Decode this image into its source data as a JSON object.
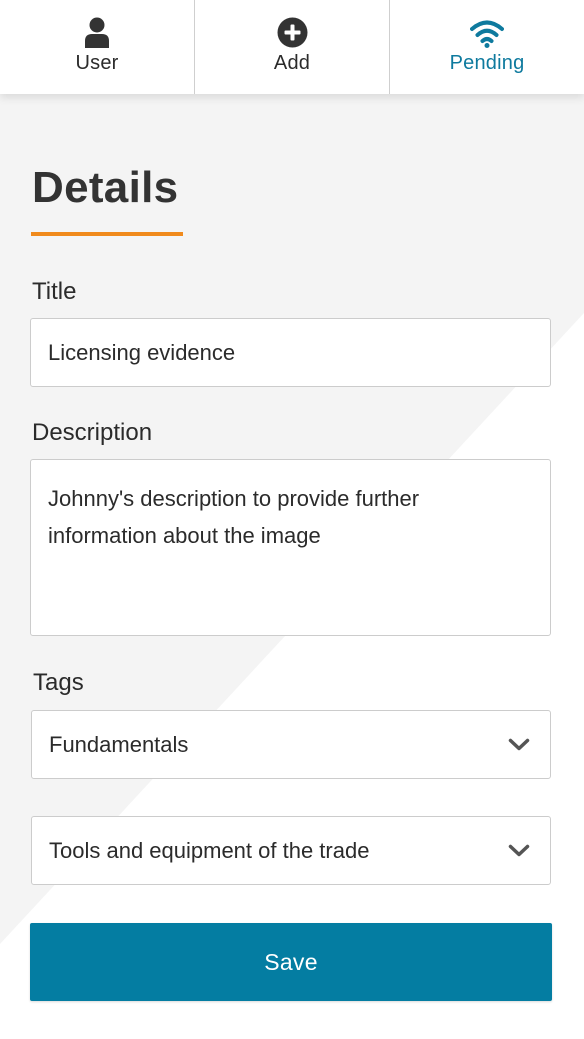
{
  "nav": {
    "items": [
      {
        "label": "User",
        "icon": "user-icon"
      },
      {
        "label": "Add",
        "icon": "plus-circle-icon"
      },
      {
        "label": "Pending",
        "icon": "wifi-icon",
        "active": true
      }
    ]
  },
  "page": {
    "title": "Details"
  },
  "form": {
    "title_label": "Title",
    "title_value": "Licensing evidence",
    "description_label": "Description",
    "description_value": "Johnny's description to provide further information about the image",
    "tags_label": "Tags",
    "tags": [
      "Fundamentals",
      "Tools and equipment of the trade"
    ],
    "save_label": "Save"
  },
  "colors": {
    "accent": "#047da2",
    "active_nav": "#0e7a9e",
    "underline": "#f08a1c",
    "background_shade": "#f4f4f4"
  }
}
